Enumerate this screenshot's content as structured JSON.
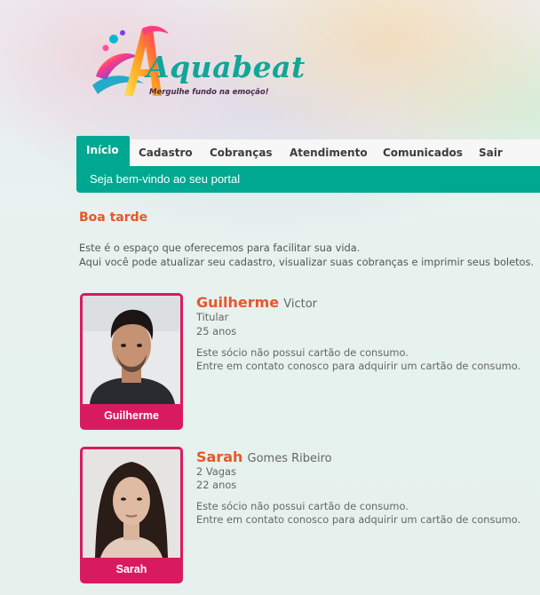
{
  "brand": {
    "name": "Aquabeat",
    "tagline": "Mergulhe fundo na emoção!"
  },
  "nav": {
    "items": [
      {
        "label": "Início",
        "active": true
      },
      {
        "label": "Cadastro"
      },
      {
        "label": "Cobranças"
      },
      {
        "label": "Atendimento"
      },
      {
        "label": "Comunicados"
      },
      {
        "label": "Sair"
      }
    ],
    "welcome": "Seja bem-vindo ao seu portal"
  },
  "greeting": "Boa tarde",
  "intro": {
    "line1": "Este é o espaço que oferecemos para facilitar sua vida.",
    "line2": "Aqui você pode atualizar seu cadastro, visualizar suas cobranças e imprimir seus boletos."
  },
  "members": [
    {
      "photo_label": "Guilherme",
      "first_name": "Guilherme",
      "last_name": "Victor",
      "role": "Titular",
      "age": "25 anos",
      "card_msg1": "Este sócio não possui cartão de consumo.",
      "card_msg2": "Entre em contato conosco para adquirir um cartão de consumo."
    },
    {
      "photo_label": "Sarah",
      "first_name": "Sarah",
      "last_name": "Gomes Ribeiro",
      "role": "2 Vagas",
      "age": "22 anos",
      "card_msg1": "Este sócio não possui cartão de consumo.",
      "card_msg2": "Entre em contato conosco para adquirir um cartão de consumo."
    }
  ],
  "colors": {
    "teal": "#00a891",
    "orange": "#e8572a",
    "magenta": "#d81b60"
  }
}
